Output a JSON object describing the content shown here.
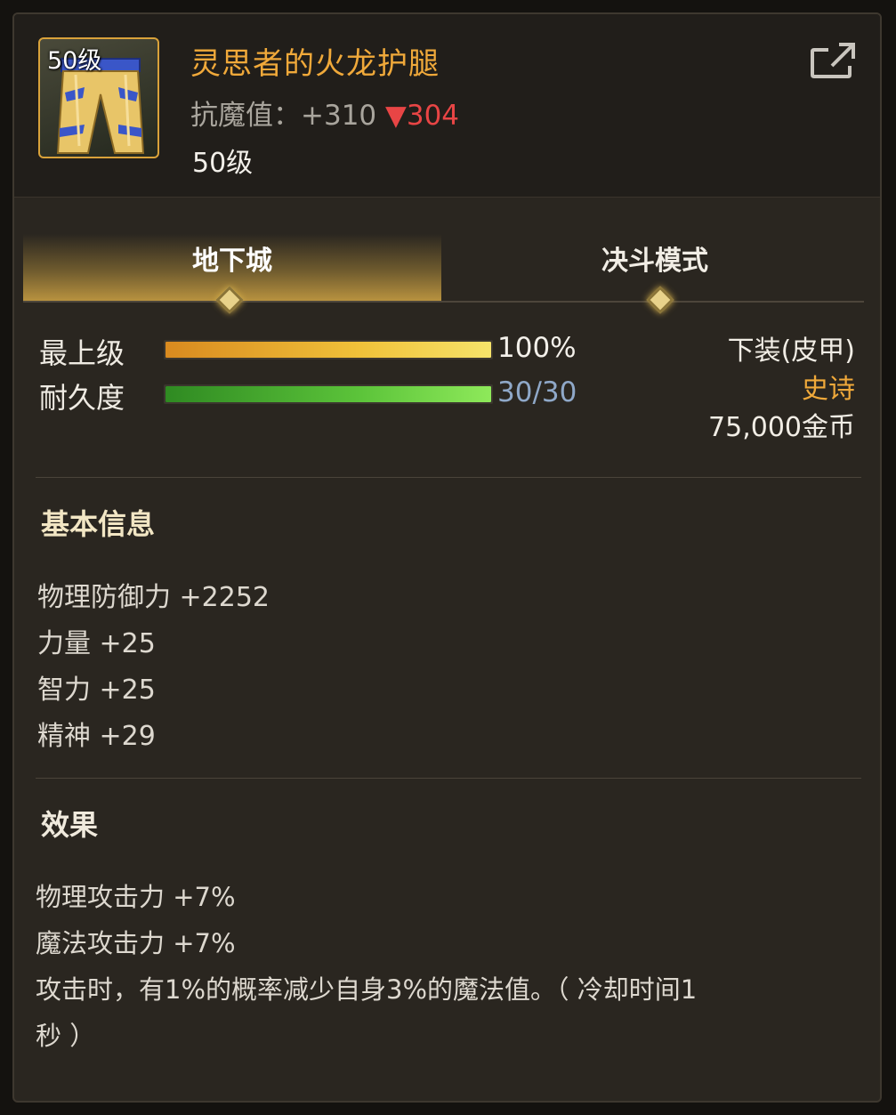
{
  "item": {
    "icon_level": "50级",
    "name": "灵思者的火龙护腿",
    "stat_prefix": "抗魔值：+310 ",
    "stat_change": "▼304",
    "level": "50级"
  },
  "tabs": [
    {
      "label": "地下城",
      "active": true
    },
    {
      "label": "决斗模式",
      "active": false
    }
  ],
  "bars": {
    "grade": {
      "label": "最上级",
      "value": "100%",
      "fraction": 1.0
    },
    "durability": {
      "label": "耐久度",
      "value": "30/30",
      "fraction": 1.0
    }
  },
  "info": {
    "slot": "下装(皮甲)",
    "rarity": "史诗",
    "price": "75,000金币"
  },
  "basic": {
    "title": "基本信息",
    "lines": [
      "物理防御力 +2252",
      "力量 +25",
      "智力 +25",
      "精神 +29"
    ]
  },
  "effect": {
    "title": "效果",
    "lines": [
      "物理攻击力 +7%",
      "魔法攻击力 +7%",
      "攻击时，有1%的概率减少自身3%的魔法值。（ 冷却时间1",
      "秒 ）"
    ]
  },
  "colors": {
    "name": "#f0a93a",
    "rarity": "#f0a93a",
    "stat_down": "#e84545",
    "durability_text": "#8fa8c8"
  },
  "icons": [
    "share-icon",
    "leg-armor-icon",
    "tab-diamond-icon"
  ]
}
